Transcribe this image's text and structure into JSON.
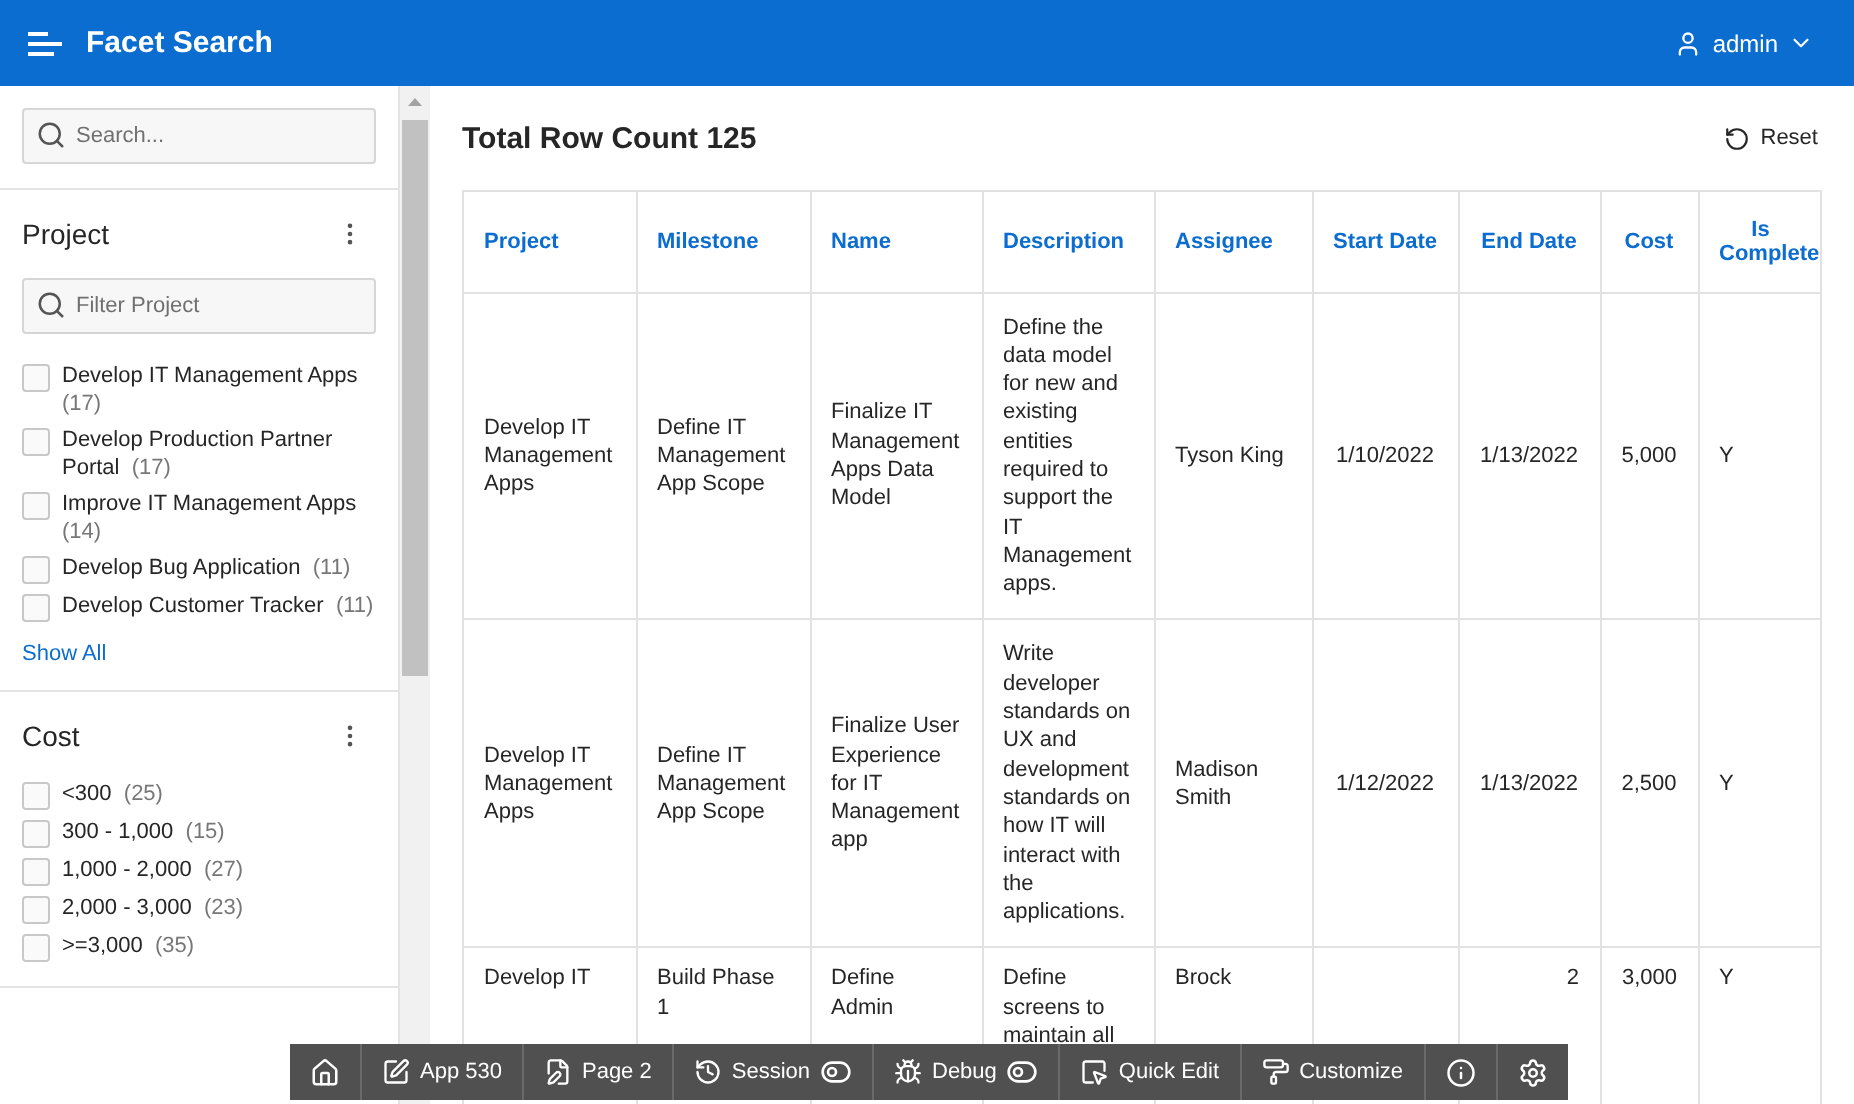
{
  "header": {
    "title": "Facet Search",
    "user": "admin"
  },
  "sidebar": {
    "search": {
      "placeholder": "Search..."
    },
    "facets": [
      {
        "title": "Project",
        "filter_placeholder": "Filter Project",
        "show_all": "Show All",
        "options": [
          {
            "label": "Develop IT Management Apps",
            "count": "(17)",
            "checked": false
          },
          {
            "label": "Develop Production Partner Portal",
            "count": "(17)",
            "checked": false
          },
          {
            "label": "Improve IT Management Apps",
            "count": "(14)",
            "checked": false
          },
          {
            "label": "Develop Bug Application",
            "count": "(11)",
            "checked": false
          },
          {
            "label": "Develop Customer Tracker",
            "count": "(11)",
            "checked": false
          }
        ]
      },
      {
        "title": "Cost",
        "options": [
          {
            "label": "<300",
            "count": "(25)",
            "checked": false
          },
          {
            "label": "300 - 1,000",
            "count": "(15)",
            "checked": false
          },
          {
            "label": "1,000 - 2,000",
            "count": "(27)",
            "checked": false
          },
          {
            "label": "2,000 - 3,000",
            "count": "(23)",
            "checked": false
          },
          {
            "label": ">=3,000",
            "count": "(35)",
            "checked": false
          }
        ]
      }
    ]
  },
  "main": {
    "title": "Total Row Count 125",
    "reset": "Reset",
    "table": {
      "columns": [
        "Project",
        "Milestone",
        "Name",
        "Description",
        "Assignee",
        "Start Date",
        "End Date",
        "Cost",
        "Is Complete"
      ],
      "rows": [
        {
          "partial": false,
          "cells": [
            "Develop IT Management Apps",
            "Define IT Management App Scope",
            "Finalize IT Management Apps Data Model",
            "Define the data model for new and existing entities required to support the IT Management apps.",
            "Tyson King",
            "1/10/2022",
            "1/13/2022",
            "5,000",
            "Y"
          ]
        },
        {
          "partial": false,
          "cells": [
            "Develop IT Management Apps",
            "Define IT Management App Scope",
            "Finalize User Experience for IT Management app",
            "Write developer standards on UX and development standards on how IT will interact with the applications.",
            "Madison Smith",
            "1/12/2022",
            "1/13/2022",
            "2,500",
            "Y"
          ]
        },
        {
          "partial": true,
          "cells": [
            "Develop IT",
            "Build Phase 1",
            "Define Admin",
            "Define screens to maintain all",
            "Brock",
            "",
            "2",
            "3,000",
            "Y"
          ]
        }
      ]
    }
  },
  "dev_toolbar": [
    {
      "kind": "home"
    },
    {
      "kind": "app",
      "label": "App 530"
    },
    {
      "kind": "page",
      "label": "Page 2"
    },
    {
      "kind": "session",
      "label": "Session"
    },
    {
      "kind": "debug",
      "label": "Debug"
    },
    {
      "kind": "quick_edit",
      "label": "Quick Edit"
    },
    {
      "kind": "customize",
      "label": "Customize"
    },
    {
      "kind": "info"
    },
    {
      "kind": "settings"
    }
  ]
}
